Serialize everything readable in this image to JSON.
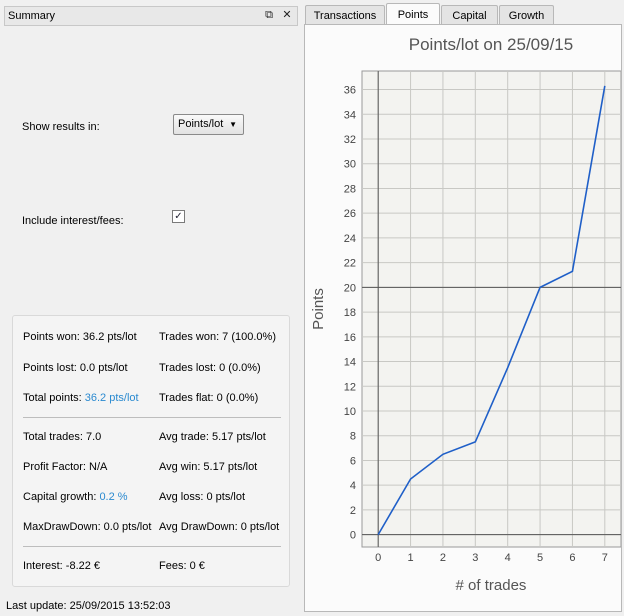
{
  "dock": {
    "title": "Summary",
    "float_icon": "⧉",
    "close_icon": "✕"
  },
  "options": {
    "show_results_label": "Show results in:",
    "show_results_value": "Points/lot",
    "include_fees_label": "Include interest/fees:",
    "include_fees_checked": true
  },
  "stats": {
    "points_won": "Points won: 36.2 pts/lot",
    "trades_won": "Trades won: 7 (100.0%)",
    "points_lost": "Points lost: 0.0 pts/lot",
    "trades_lost": "Trades lost: 0 (0.0%)",
    "total_points_label": "Total points: ",
    "total_points_value": "36.2 pts/lot",
    "trades_flat": "Trades flat: 0 (0.0%)",
    "total_trades": "Total trades: 7.0",
    "avg_trade": "Avg trade: 5.17 pts/lot",
    "profit_factor": "Profit Factor: N/A",
    "avg_win": "Avg win: 5.17 pts/lot",
    "capital_growth_label": "Capital growth: ",
    "capital_growth_value": "0.2 %",
    "avg_loss": "Avg loss: 0 pts/lot",
    "max_drawdown": "MaxDrawDown: 0.0 pts/lot",
    "avg_drawdown": "Avg DrawDown: 0 pts/lot",
    "interest": "Interest: -8.22 €",
    "fees": "Fees: 0 €"
  },
  "last_update": "Last update: 25/09/2015 13:52:03",
  "tabs": [
    "Transactions",
    "Points",
    "Capital",
    "Growth"
  ],
  "active_tab": 1,
  "colors": {
    "line": "#1f5fc8",
    "highlight": "#2a8ad0"
  },
  "chart_data": {
    "type": "line",
    "title": "Points/lot on 25/09/15",
    "xlabel": "# of trades",
    "ylabel": "Points",
    "x": [
      0,
      1,
      2,
      3,
      4,
      5,
      6,
      7
    ],
    "series": [
      {
        "values": [
          0,
          4.5,
          6.5,
          7.5,
          13.5,
          20,
          21.3,
          36.3
        ]
      }
    ],
    "xlim": [
      -0.5,
      7.5
    ],
    "ylim": [
      -1,
      37.5
    ],
    "x_ticks": [
      0,
      1,
      2,
      3,
      4,
      5,
      6,
      7
    ],
    "y_ticks": [
      0,
      2,
      4,
      6,
      8,
      10,
      12,
      14,
      16,
      18,
      20,
      22,
      24,
      26,
      28,
      30,
      32,
      34,
      36
    ],
    "grid": true
  }
}
